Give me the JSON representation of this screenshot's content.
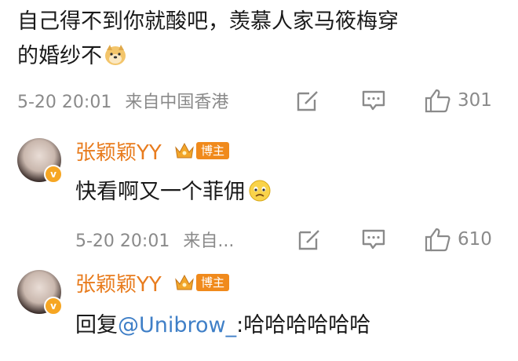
{
  "post": {
    "text_line1": "自己得不到你就酸吧，羡慕人家马筱梅穿",
    "text_line2": "的婚纱不",
    "emoji": "doge-emoji",
    "time": "5-20 20:01",
    "location": "来自中国香港",
    "like_count": "301"
  },
  "replies": [
    {
      "username": "张颖颖YY",
      "tag": "博主",
      "text": "快看啊又一个菲佣",
      "emoji": "sad-face-emoji",
      "time": "5-20 20:01",
      "location": "来自...",
      "like_count": "610"
    },
    {
      "username": "张颖颖YY",
      "tag": "博主",
      "reply_prefix": "回复",
      "mention": "@Unibrow_",
      "text": ":哈哈哈哈哈哈"
    }
  ],
  "colors": {
    "username": "#e87c1e",
    "mention": "#3f7fc7",
    "meta": "#8a8a8a",
    "blogger_tag_bg": "#f08a1c"
  },
  "icons": [
    "edit-icon",
    "comment-icon",
    "like-icon",
    "crown-icon",
    "verified-icon"
  ]
}
